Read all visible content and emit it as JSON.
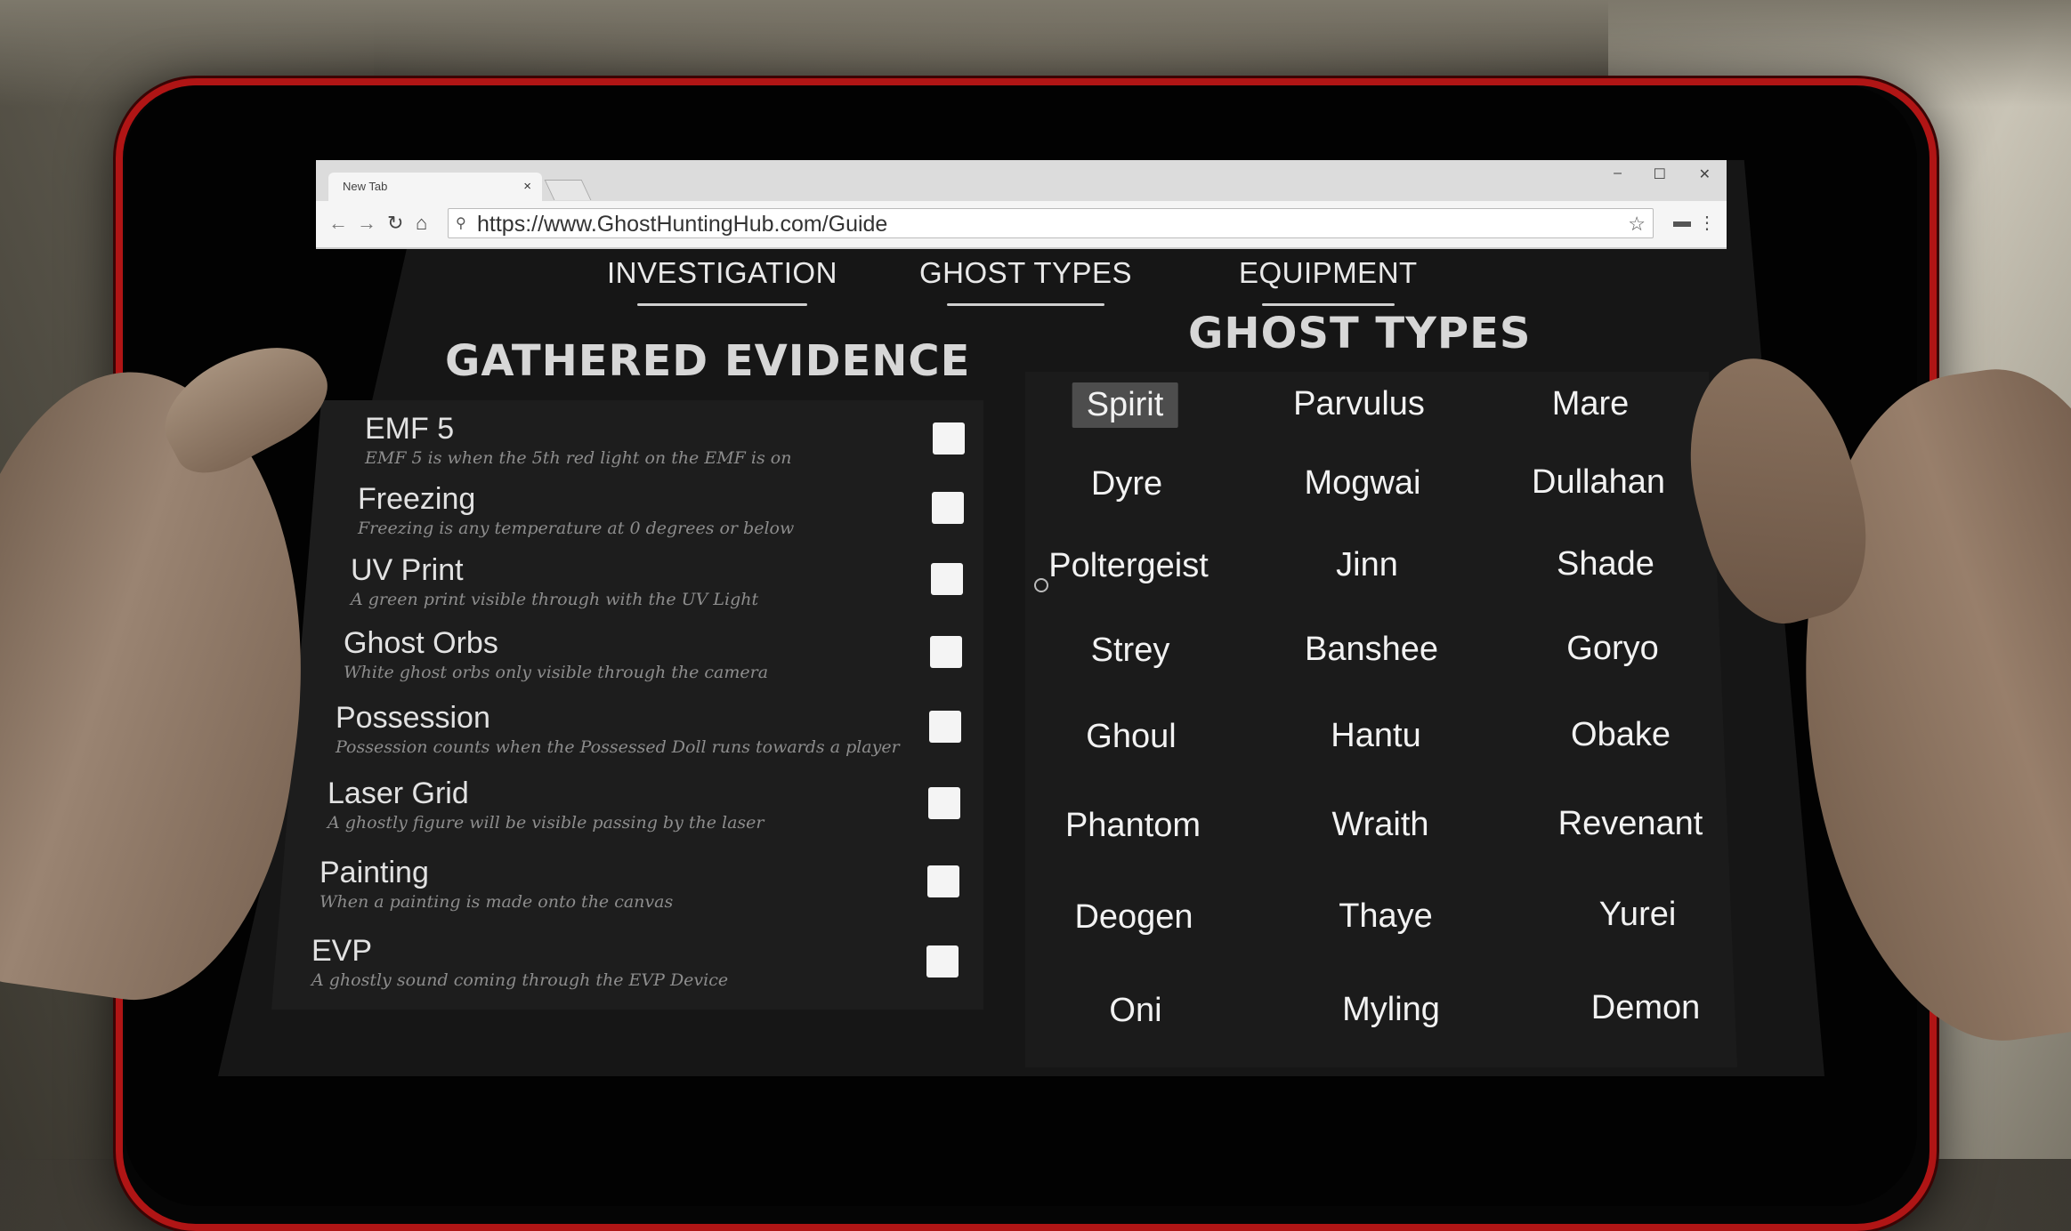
{
  "browser": {
    "tab_title": "New Tab",
    "tab_close": "×",
    "url": "https://www.GhostHuntingHub.com/Guide",
    "window_controls": {
      "minimize": "–",
      "maximize": "☐",
      "close": "✕"
    },
    "nav_icons": {
      "back": "back-arrow-icon",
      "forward": "forward-arrow-icon",
      "reload": "reload-icon",
      "home": "home-icon"
    }
  },
  "nav": {
    "items": [
      {
        "label": "INVESTIGATION"
      },
      {
        "label": "GHOST TYPES"
      },
      {
        "label": "EQUIPMENT"
      }
    ],
    "active": "GHOST TYPES"
  },
  "evidence": {
    "heading": "GATHERED EVIDENCE",
    "items": [
      {
        "title": "EMF 5",
        "desc": "EMF 5 is when the 5th red light on the EMF is on",
        "checked": false
      },
      {
        "title": "Freezing",
        "desc": "Freezing is any temperature at 0 degrees or below",
        "checked": false
      },
      {
        "title": "UV Print",
        "desc": "A green print visible through with the UV Light",
        "checked": false
      },
      {
        "title": "Ghost Orbs",
        "desc": "White ghost orbs only visible through the camera",
        "checked": false
      },
      {
        "title": "Possession",
        "desc": "Possession counts when the Possessed Doll runs towards a player",
        "checked": false
      },
      {
        "title": "Laser Grid",
        "desc": "A ghostly figure will be visible passing by the laser",
        "checked": false
      },
      {
        "title": "Painting",
        "desc": "When a painting is made onto the canvas",
        "checked": false
      },
      {
        "title": "EVP",
        "desc": "A ghostly sound coming through the EVP Device",
        "checked": false
      }
    ]
  },
  "ghosts": {
    "heading": "GHOST TYPES",
    "selected": "Spirit",
    "rows": [
      [
        "Spirit",
        "Parvulus",
        "Mare"
      ],
      [
        "Dyre",
        "Mogwai",
        "Dullahan"
      ],
      [
        "Poltergeist",
        "Jinn",
        "Shade"
      ],
      [
        "Strey",
        "Banshee",
        "Goryo"
      ],
      [
        "Ghoul",
        "Hantu",
        "Obake"
      ],
      [
        "Phantom",
        "Wraith",
        "Revenant"
      ],
      [
        "Deogen",
        "Thaye",
        "Yurei"
      ],
      [
        "Oni",
        "Myling",
        "Demon"
      ]
    ]
  },
  "colors": {
    "tablet_frame": "#b01515",
    "screen_bg": "#161616",
    "panel_bg": "#1d1d1d",
    "selected_bg": "#4d4d4d",
    "text": "#f2f2f2"
  }
}
